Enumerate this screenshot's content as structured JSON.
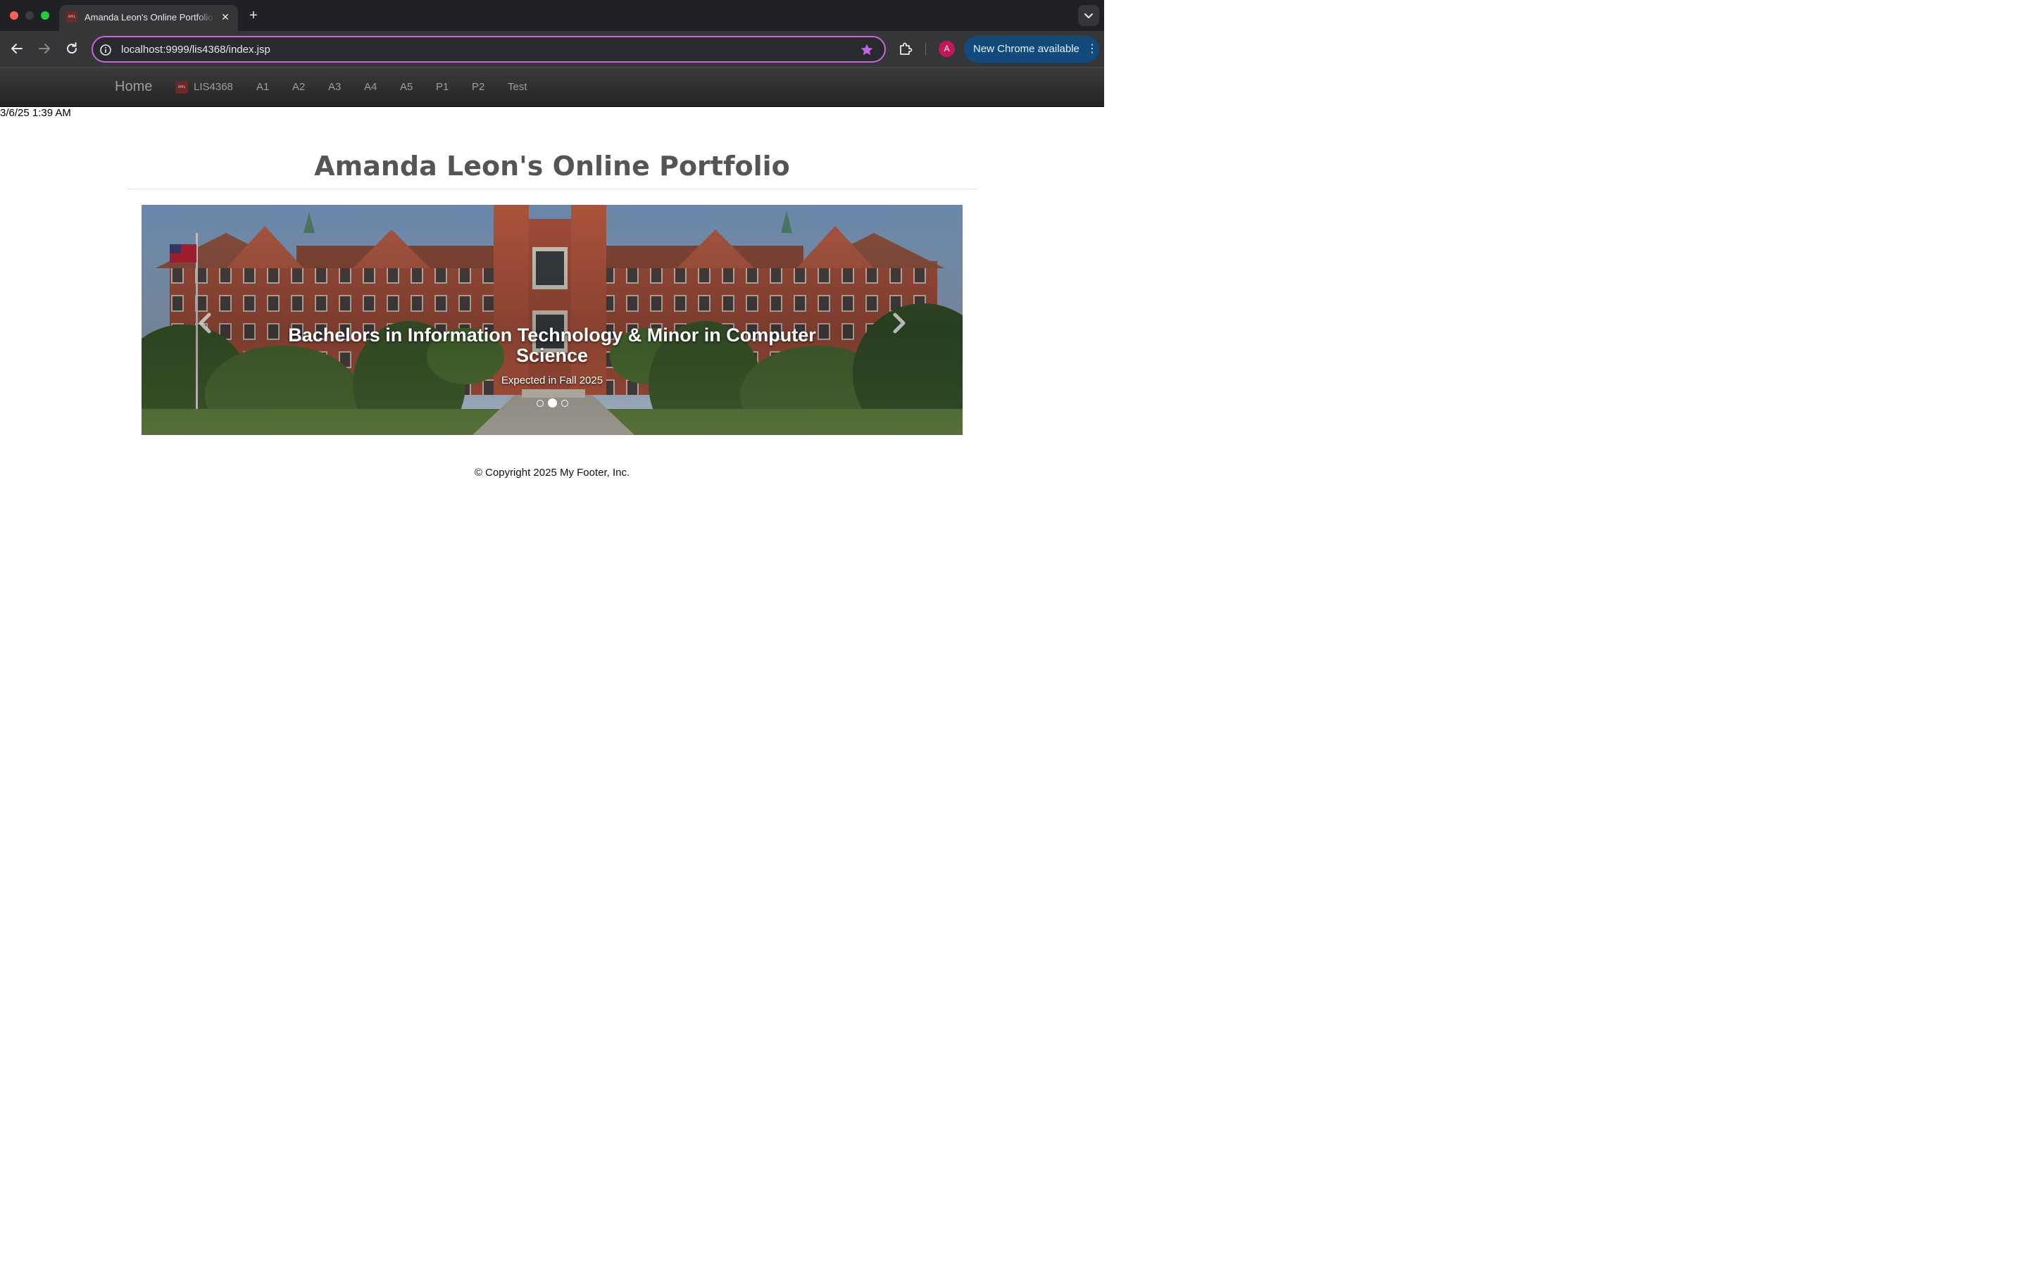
{
  "browser": {
    "tab": {
      "title": "Amanda Leon's Online Portfolio",
      "favicon_text": "AML",
      "close_glyph": "✕"
    },
    "new_tab_glyph": "+",
    "address": "localhost:9999/lis4368/index.jsp",
    "profile_initial": "A",
    "update_button": {
      "label": "New Chrome available",
      "menu_glyph": "⋮"
    },
    "colors": {
      "tab_strip": "#202124",
      "toolbar": "#353638",
      "omnibox_border": "#c466e0",
      "bookmark_star": "#c466e0",
      "profile_avatar": "#c2185b",
      "update_button": "#114a7b"
    },
    "icons": [
      "back-arrow-icon",
      "forward-arrow-icon",
      "reload-icon",
      "site-info-icon",
      "bookmark-star-icon",
      "extensions-icon",
      "tab-search-chevron-icon"
    ]
  },
  "navbar": {
    "brand": "Home",
    "favicon_text": "AML",
    "links": [
      "LIS4368",
      "A1",
      "A2",
      "A3",
      "A4",
      "A5",
      "P1",
      "P2",
      "Test"
    ]
  },
  "datetime": "3/6/25 1:39 AM",
  "page_title": "Amanda Leon's Online Portfolio",
  "carousel": {
    "slide_title": "Bachelors in Information Technology & Minor in Computer Science",
    "slide_subtitle": "Expected in Fall 2025",
    "slide_count": 3,
    "active_slide": 2,
    "prev_glyph": "‹",
    "next_glyph": "›"
  },
  "footer": "© Copyright 2025 My Footer, Inc."
}
